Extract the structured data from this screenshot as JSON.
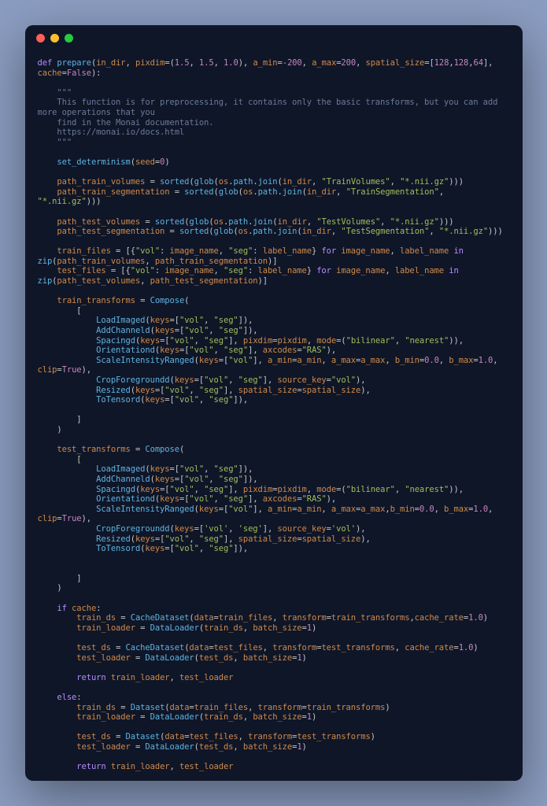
{
  "titlebar": {
    "buttons": [
      "close",
      "minimize",
      "zoom"
    ]
  },
  "code": {
    "t": {
      "def": "def",
      "for": "for",
      "in": "in",
      "if": "if",
      "else": "else",
      "return": "return",
      "True": "True",
      "False": "False",
      "prepare": "prepare",
      "in_dir": "in_dir",
      "pixdim": "pixdim",
      "a_min": "a_min",
      "a_max": "a_max",
      "spatial_size": "spatial_size",
      "cache": "cache",
      "cache_rate": "cache_rate",
      "data": "data",
      "transform": "transform",
      "batch_size": "batch_size",
      "seed": "seed",
      "clip": "clip",
      "keys": "keys",
      "mode": "mode",
      "axcodes": "axcodes",
      "b_min": "b_min",
      "b_max": "b_max",
      "source_key": "source_key",
      "set_determinism": "set_determinism",
      "sorted": "sorted",
      "glob": "glob",
      "os": "os",
      "path": "path",
      "join": "join",
      "zip": "zip",
      "Compose": "Compose",
      "LoadImaged": "LoadImaged",
      "AddChanneld": "AddChanneld",
      "Spacingd": "Spacingd",
      "Orientationd": "Orientationd",
      "ScaleIntensityRanged": "ScaleIntensityRanged",
      "CropForegroundd": "CropForegroundd",
      "Resized": "Resized",
      "ToTensord": "ToTensord",
      "CacheDataset": "CacheDataset",
      "Dataset": "Dataset",
      "DataLoader": "DataLoader",
      "path_train_volumes": "path_train_volumes",
      "path_train_segmentation": "path_train_segmentation",
      "path_test_volumes": "path_test_volumes",
      "path_test_segmentation": "path_test_segmentation",
      "train_files": "train_files",
      "test_files": "test_files",
      "image_name": "image_name",
      "label_name": "label_name",
      "train_transforms": "train_transforms",
      "test_transforms": "test_transforms",
      "train_ds": "train_ds",
      "train_loader": "train_loader",
      "test_ds": "test_ds",
      "test_loader": "test_loader"
    },
    "s": {
      "vol": "\"vol\"",
      "seg": "\"seg\"",
      "vol_sq": "'vol'",
      "seg_sq": "'seg'",
      "RAS": "\"RAS\"",
      "bilinear": "\"bilinear\"",
      "nearest": "\"nearest\"",
      "TrainVolumes": "\"TrainVolumes\"",
      "TrainSegmentation": "\"TrainSegmentation\"",
      "TestVolumes": "\"TestVolumes\"",
      "TestSegmentation": "\"TestSegmentation\"",
      "nii": "\"*.nii.gz\"",
      "tq": "\"\"\"",
      "doc1": "    This function is for preprocessing, it contains only the basic transforms, but you can add more operations that you ",
      "doc2": "    find in the Monai documentation.",
      "doc3": "    https://monai.io/docs.html",
      "empty": ""
    },
    "n": {
      "p15": "1.5",
      "p10": "1.0",
      "m200": "-200",
      "p200": "200",
      "p128": "128",
      "p64": "64",
      "p0": "0",
      "p00": "0.0",
      "p1": "1"
    }
  }
}
